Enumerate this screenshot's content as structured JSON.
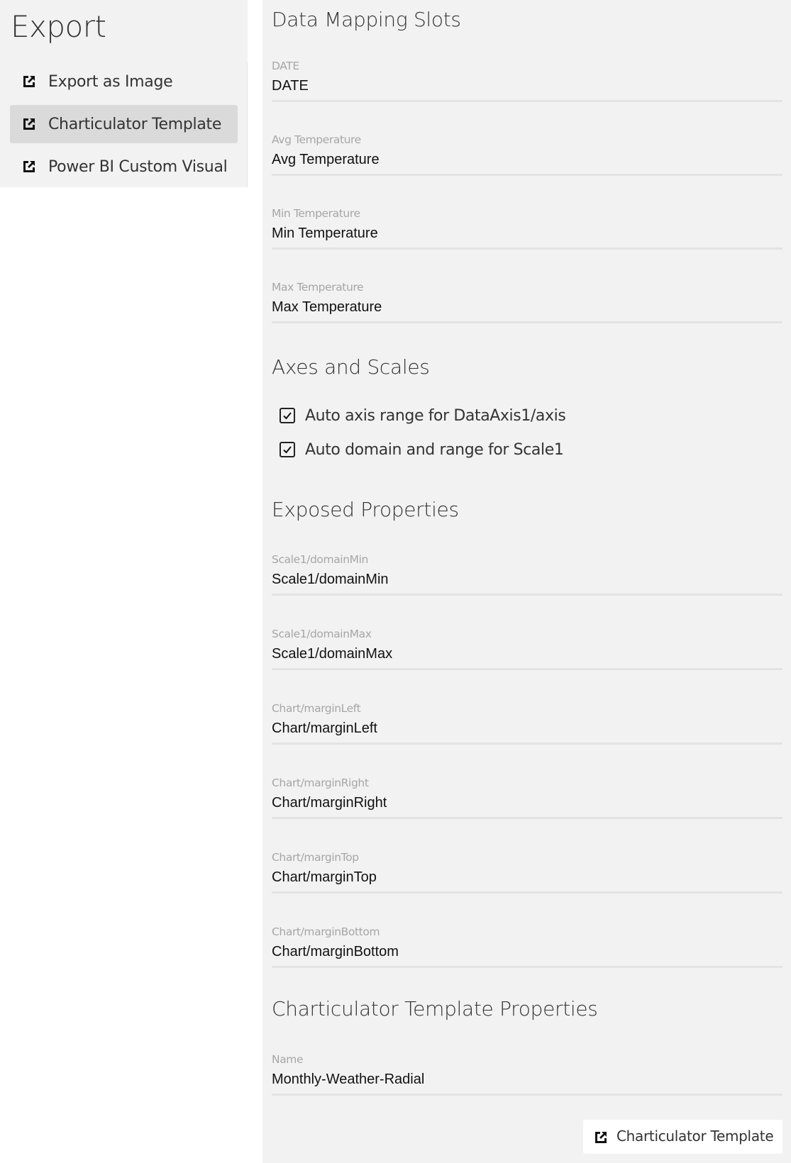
{
  "sidebar": {
    "title": "Export",
    "items": [
      {
        "label": "Export as Image",
        "icon": "export-icon",
        "active": false
      },
      {
        "label": "Charticulator Template",
        "icon": "export-icon",
        "active": true
      },
      {
        "label": "Power BI Custom Visual",
        "icon": "export-icon",
        "active": false
      }
    ]
  },
  "main": {
    "data_mapping": {
      "heading": "Data Mapping Slots",
      "fields": [
        {
          "label": "DATE",
          "value": "DATE"
        },
        {
          "label": "Avg Temperature",
          "value": "Avg Temperature"
        },
        {
          "label": "Min Temperature",
          "value": "Min Temperature"
        },
        {
          "label": "Max Temperature",
          "value": "Max Temperature"
        }
      ]
    },
    "axes_scales": {
      "heading": "Axes and Scales",
      "checkboxes": [
        {
          "label": "Auto axis range for DataAxis1/axis",
          "checked": true
        },
        {
          "label": "Auto domain and range for Scale1",
          "checked": true
        }
      ]
    },
    "exposed_properties": {
      "heading": "Exposed Properties",
      "fields": [
        {
          "label": "Scale1/domainMin",
          "value": "Scale1/domainMin"
        },
        {
          "label": "Scale1/domainMax",
          "value": "Scale1/domainMax"
        },
        {
          "label": "Chart/marginLeft",
          "value": "Chart/marginLeft"
        },
        {
          "label": "Chart/marginRight",
          "value": "Chart/marginRight"
        },
        {
          "label": "Chart/marginTop",
          "value": "Chart/marginTop"
        },
        {
          "label": "Chart/marginBottom",
          "value": "Chart/marginBottom"
        }
      ]
    },
    "template_properties": {
      "heading": "Charticulator Template Properties",
      "fields": [
        {
          "label": "Name",
          "value": "Monthly-Weather-Radial"
        }
      ]
    },
    "export_button": {
      "label": "Charticulator Template",
      "icon": "export-icon"
    }
  }
}
